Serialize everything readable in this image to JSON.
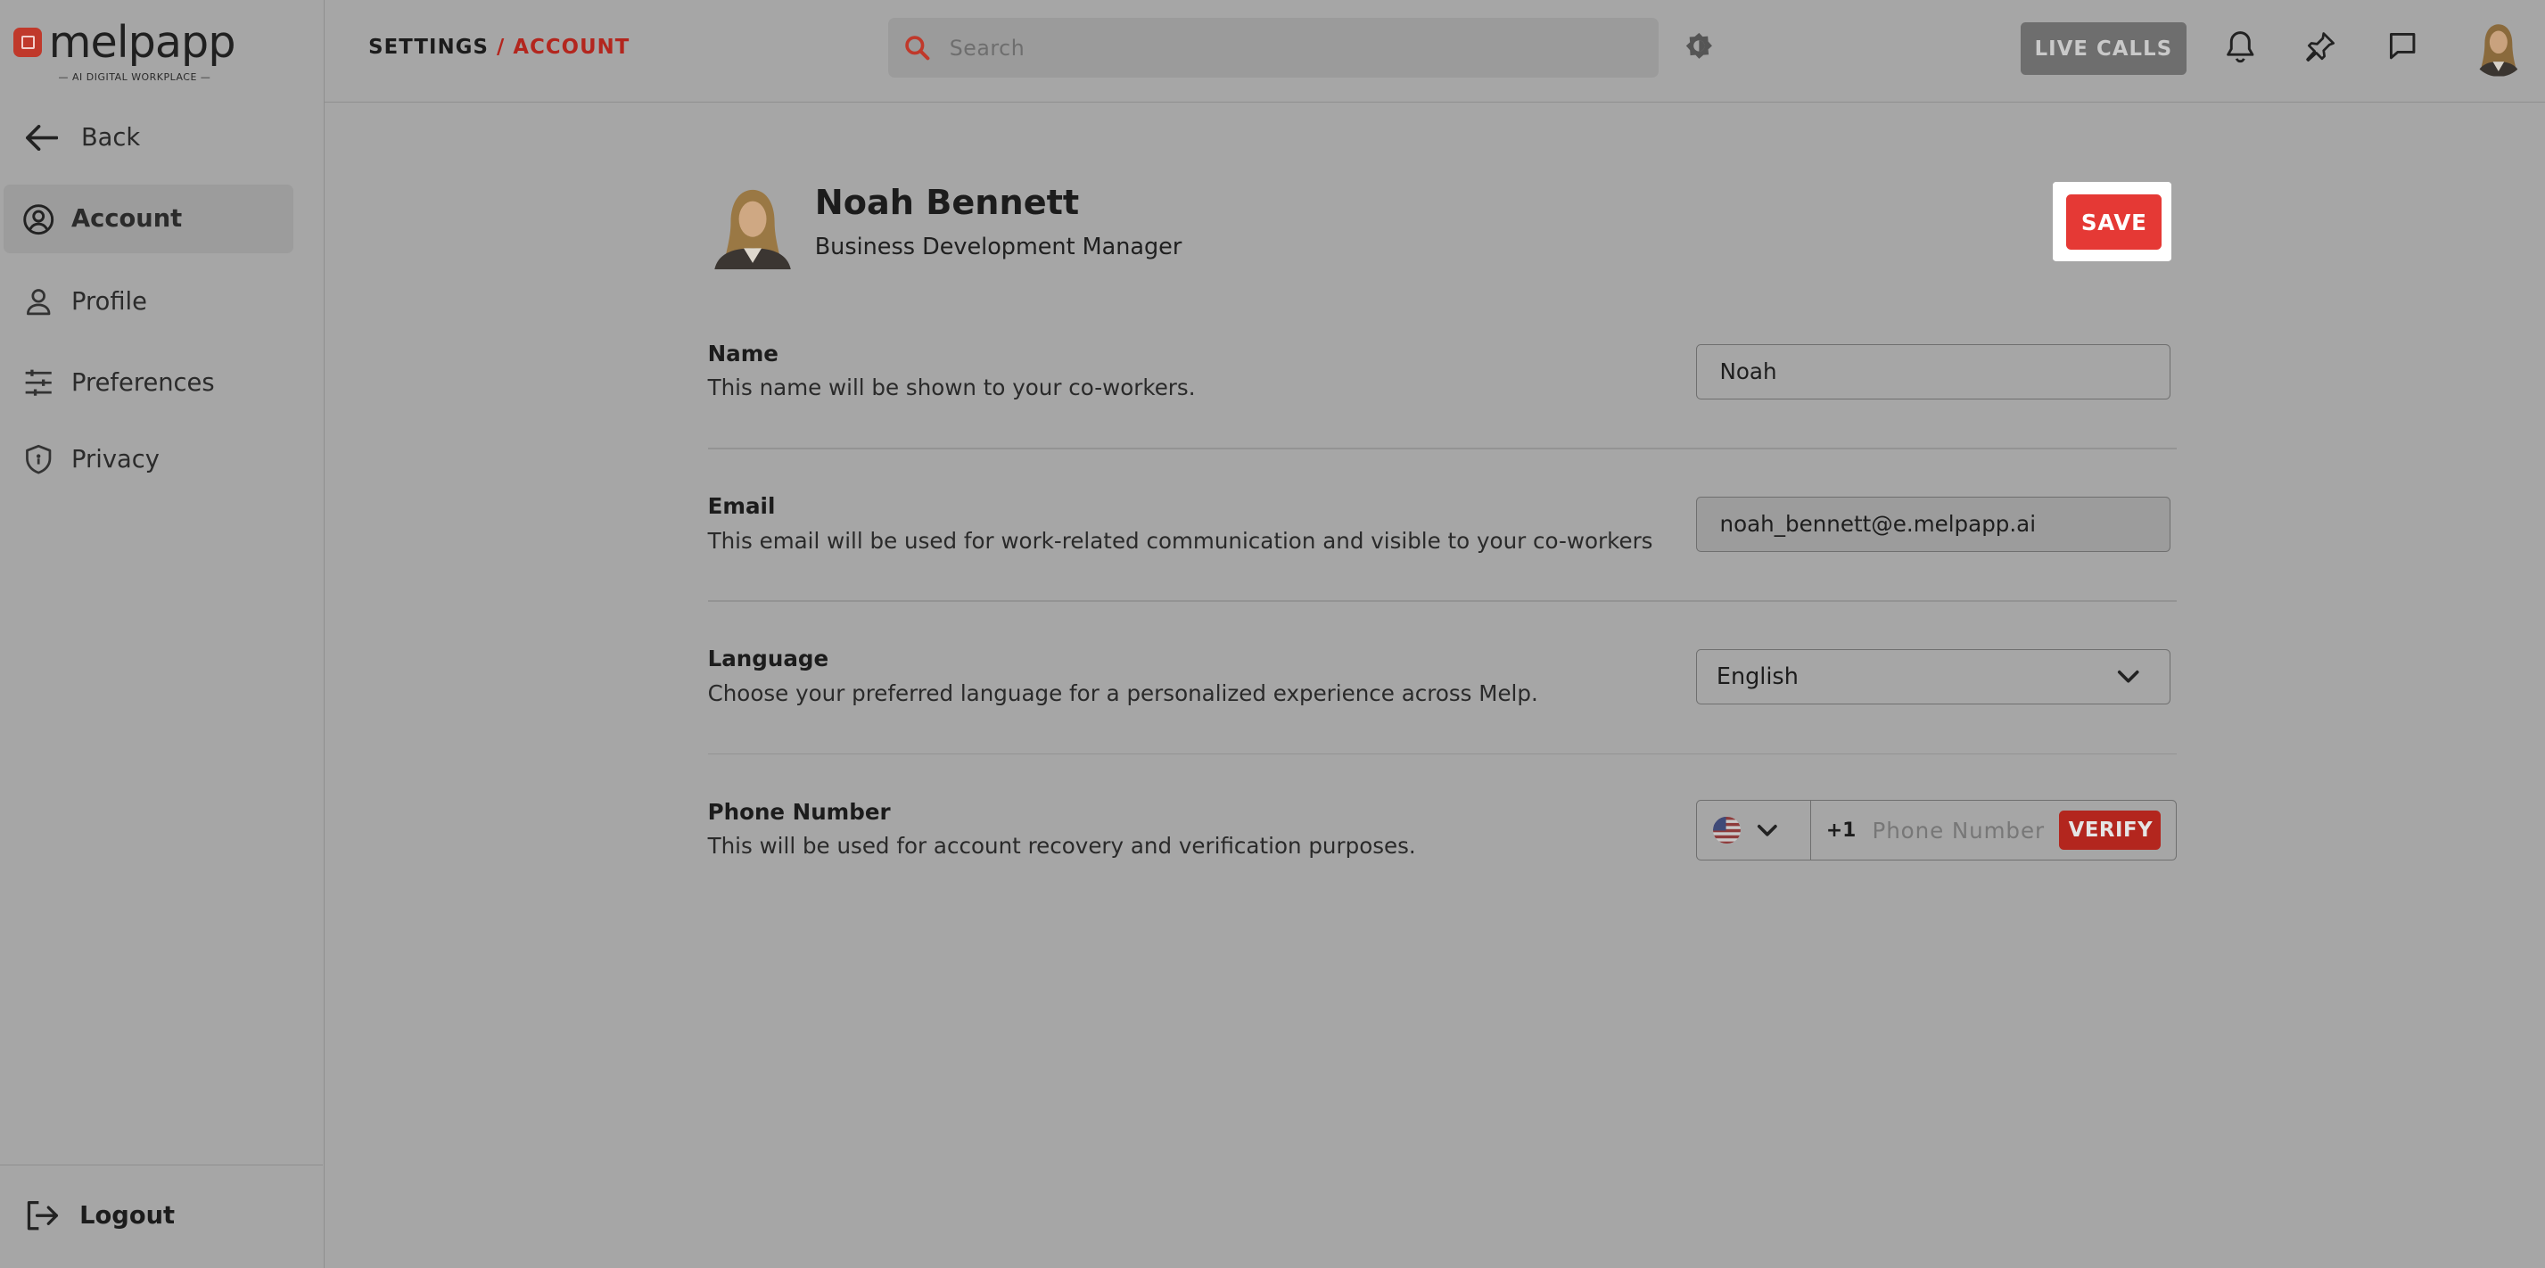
{
  "app": {
    "logo_text": "melpapp",
    "logo_tagline": "— AI DIGITAL WORKPLACE —"
  },
  "sidebar": {
    "back_label": "Back",
    "items": [
      {
        "label": "Account",
        "icon": "user-circle-icon",
        "active": true
      },
      {
        "label": "Profile",
        "icon": "person-icon",
        "active": false
      },
      {
        "label": "Preferences",
        "icon": "sliders-icon",
        "active": false
      },
      {
        "label": "Privacy",
        "icon": "shield-icon",
        "active": false
      }
    ],
    "logout_label": "Logout"
  },
  "header": {
    "breadcrumb": {
      "root": "SETTINGS",
      "separator": "/",
      "current": "ACCOUNT"
    },
    "search_placeholder": "Search",
    "live_calls_label": "LIVE CALLS",
    "icons": [
      "theme-toggle-icon",
      "bell-icon",
      "pin-icon",
      "chat-icon"
    ]
  },
  "profile": {
    "name": "Noah Bennett",
    "role": "Business Development Manager",
    "save_label": "SAVE"
  },
  "form": {
    "name": {
      "title": "Name",
      "description": "This name will be shown to your co-workers.",
      "value": "Noah"
    },
    "email": {
      "title": "Email",
      "description": "This email will be used for work-related communication and visible to your co-workers",
      "value": "noah_bennett@e.melpapp.ai"
    },
    "language": {
      "title": "Language",
      "description": "Choose your preferred language for a personalized experience across Melp.",
      "value": "English"
    },
    "phone": {
      "title": "Phone Number",
      "description": "This will be used for account recovery and verification purposes.",
      "country": "us-flag-icon",
      "dial_code": "+1",
      "placeholder": "Phone Number",
      "verify_label": "VERIFY"
    }
  },
  "colors": {
    "accent": "#b3261e",
    "save_button": "#e53935",
    "overlay_bg": "#a6a6a6"
  }
}
